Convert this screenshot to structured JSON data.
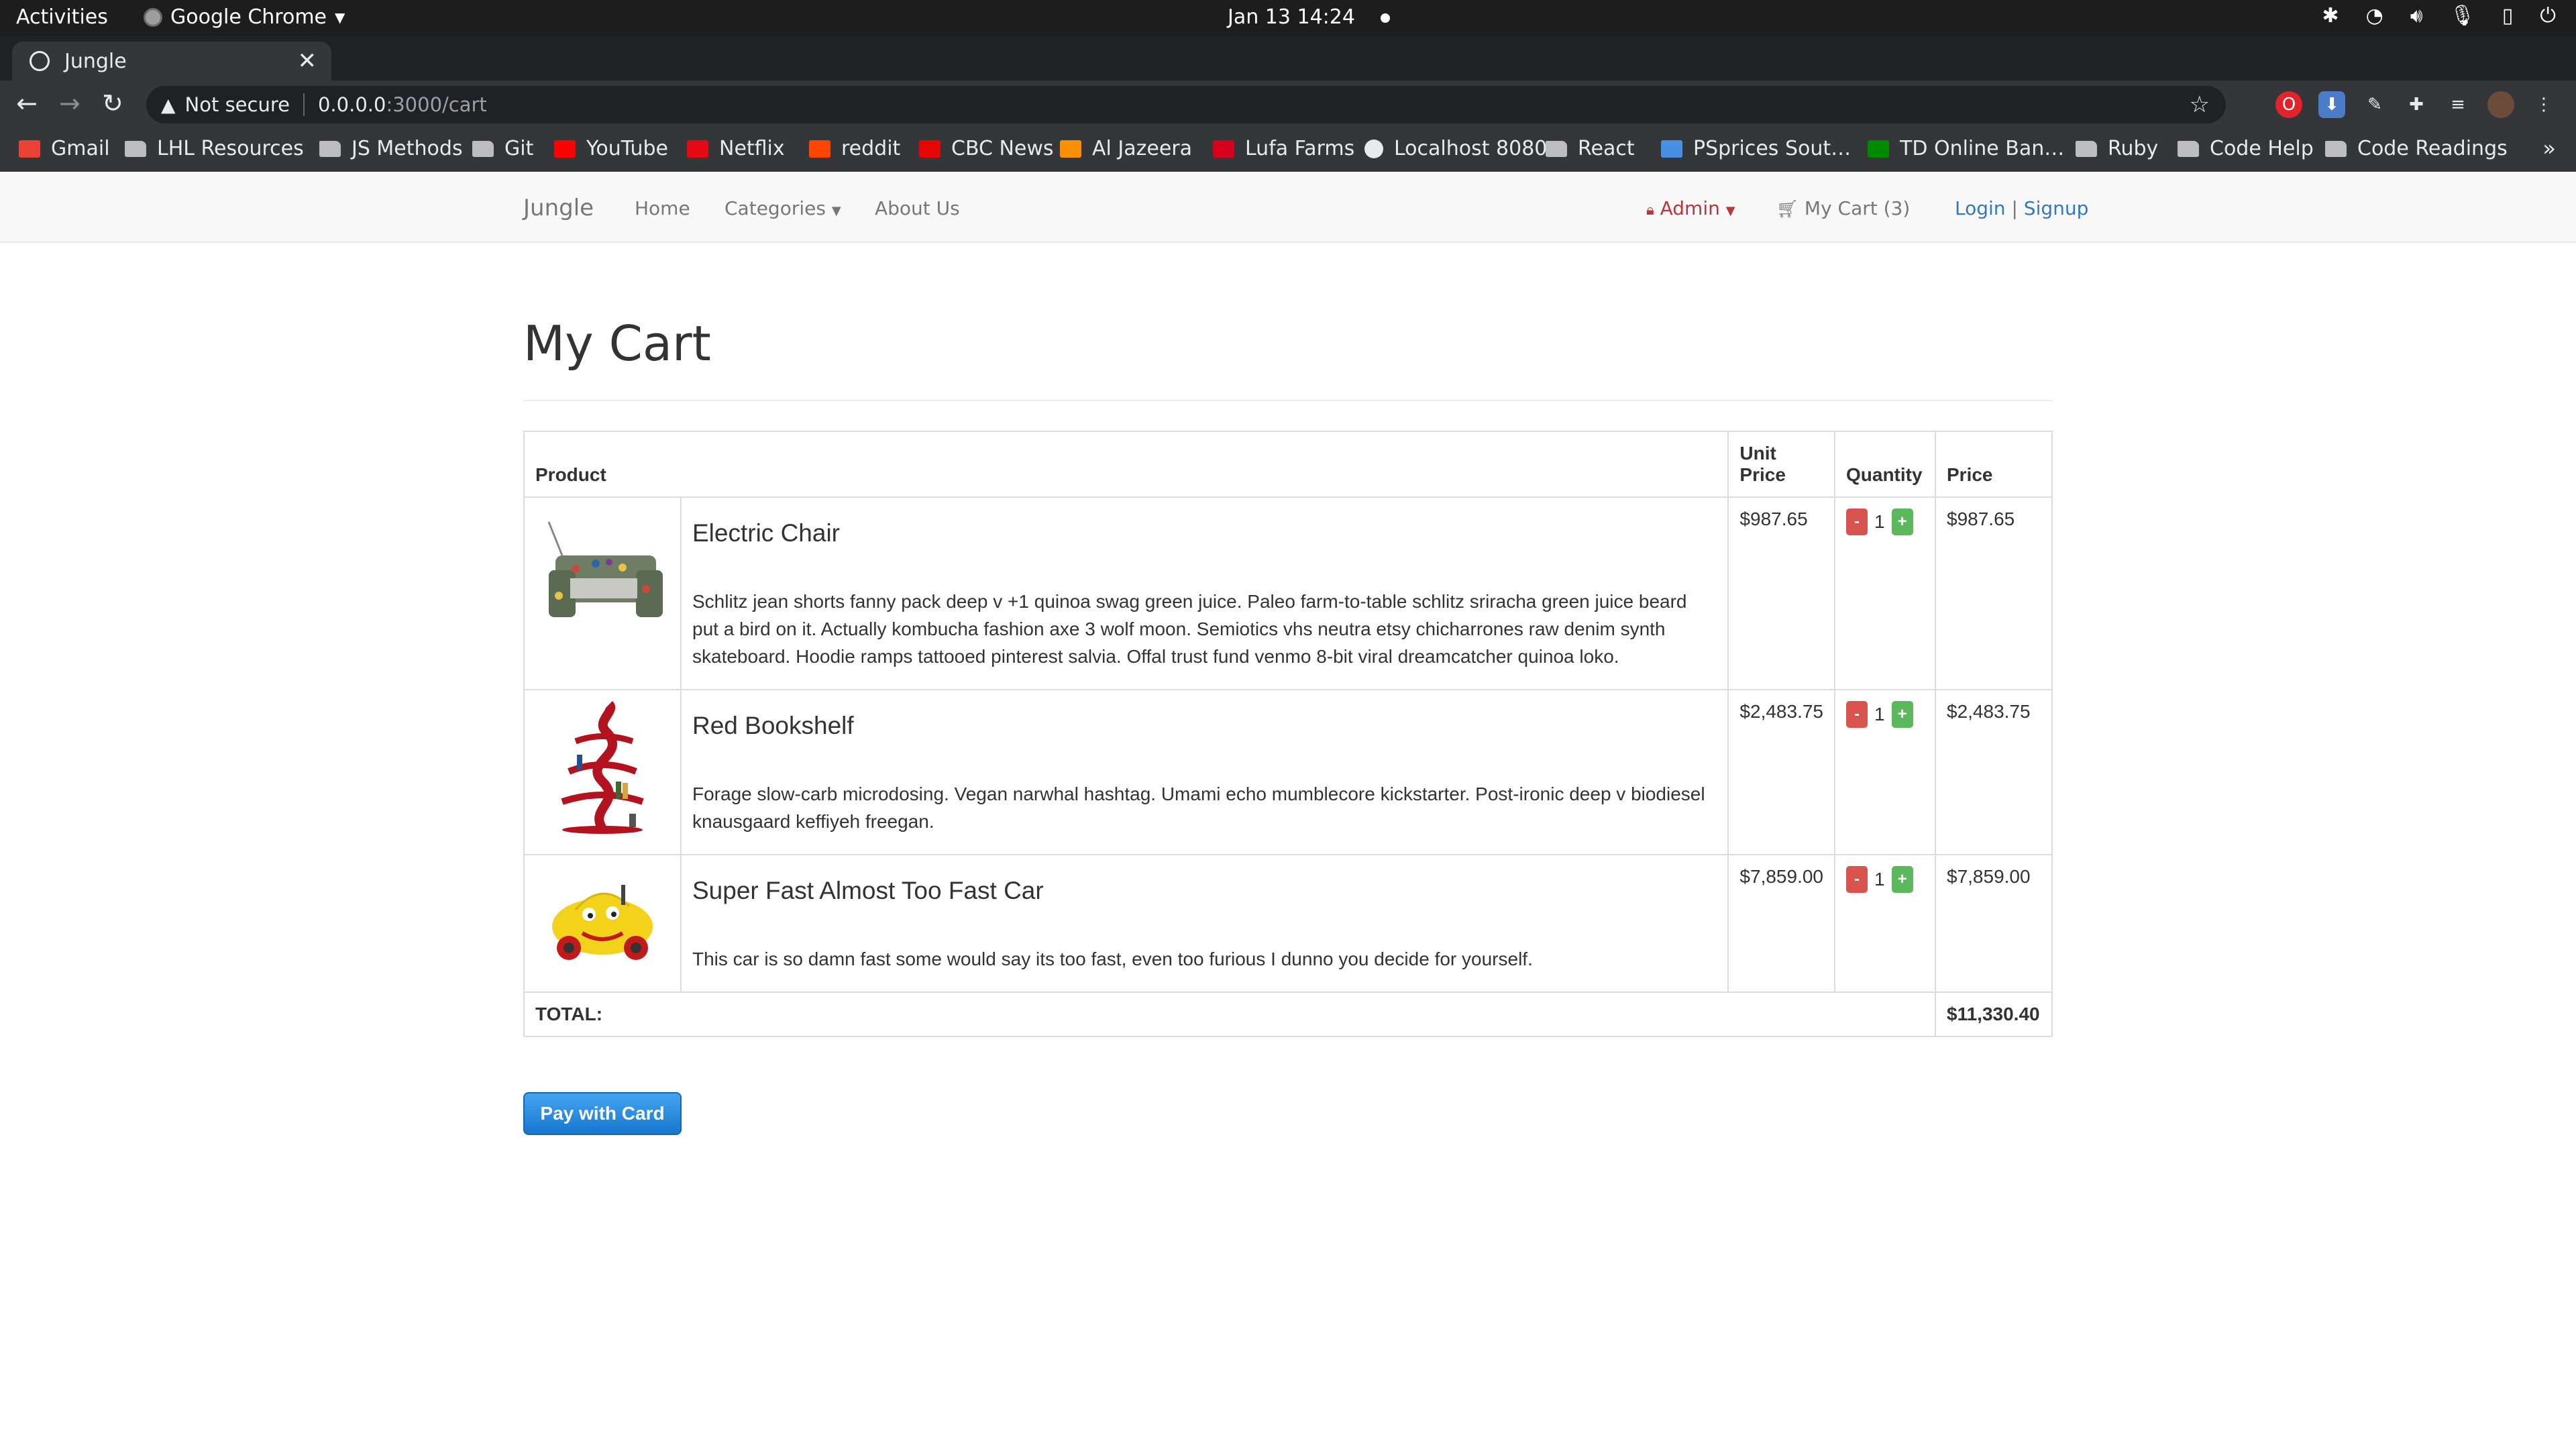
{
  "os": {
    "activities": "Activities",
    "app_name": "Google Chrome",
    "clock": "Jan 13  14:24"
  },
  "browser": {
    "tab_title": "Jungle",
    "omnibox": {
      "security": "Not secure",
      "host": "0.0.0.0",
      "path": ":3000/cart"
    },
    "bookmarks": [
      {
        "label": "Gmail",
        "icon": "gmail-icon",
        "color": "#ea4335"
      },
      {
        "label": "LHL Resources",
        "icon": "folder-icon"
      },
      {
        "label": "JS Methods",
        "icon": "folder-icon"
      },
      {
        "label": "Git",
        "icon": "folder-icon"
      },
      {
        "label": "YouTube",
        "icon": "youtube-icon",
        "color": "#ff0000"
      },
      {
        "label": "Netflix",
        "icon": "netflix-icon",
        "color": "#e50914"
      },
      {
        "label": "reddit",
        "icon": "reddit-icon",
        "color": "#ff4500"
      },
      {
        "label": "CBC News",
        "icon": "cbc-icon",
        "color": "#e60505"
      },
      {
        "label": "Al Jazeera",
        "icon": "aljazeera-icon",
        "color": "#fa9000"
      },
      {
        "label": "Lufa Farms",
        "icon": "lufa-icon",
        "color": "#d6001c"
      },
      {
        "label": "Localhost 8080",
        "icon": "globe-icon"
      },
      {
        "label": "React",
        "icon": "folder-icon"
      },
      {
        "label": "PSprices Sout…",
        "icon": "psprices-icon",
        "color": "#4a90e2"
      },
      {
        "label": "TD Online Ban…",
        "icon": "td-icon",
        "color": "#008a00"
      },
      {
        "label": "Ruby",
        "icon": "folder-icon"
      },
      {
        "label": "Code Help",
        "icon": "folder-icon"
      },
      {
        "label": "Code Readings",
        "icon": "folder-icon"
      }
    ]
  },
  "site_nav": {
    "brand": "Jungle",
    "home": "Home",
    "categories": "Categories",
    "about": "About Us",
    "admin": "Admin",
    "cart": "My Cart (3)",
    "login": "Login",
    "separator": "|",
    "signup": "Signup"
  },
  "page": {
    "title": "My Cart",
    "table": {
      "headers": {
        "product": "Product",
        "unit_price": "Unit Price",
        "quantity": "Quantity",
        "price": "Price"
      },
      "rows": [
        {
          "name": "Electric Chair",
          "description": "Schlitz jean shorts fanny pack deep v +1 quinoa swag green juice. Paleo farm-to-table schlitz sriracha green juice beard put a bird on it. Actually kombucha fashion axe 3 wolf moon. Semiotics vhs neutra etsy chicharrones raw denim synth skateboard. Hoodie ramps tattooed pinterest salvia. Offal trust fund venmo 8-bit viral dreamcatcher quinoa loko.",
          "unit_price": "$987.65",
          "quantity": "1",
          "price": "$987.65"
        },
        {
          "name": "Red Bookshelf",
          "description": "Forage slow-carb microdosing. Vegan narwhal hashtag. Umami echo mumblecore kickstarter. Post-ironic deep v biodiesel knausgaard keffiyeh freegan.",
          "unit_price": "$2,483.75",
          "quantity": "1",
          "price": "$2,483.75"
        },
        {
          "name": "Super Fast Almost Too Fast Car",
          "description": "This car is so damn fast some would say its too fast, even too furious I dunno you decide for yourself.",
          "unit_price": "$7,859.00",
          "quantity": "1",
          "price": "$7,859.00"
        }
      ],
      "total_label": "TOTAL:",
      "total_value": "$11,330.40",
      "minus_label": "-",
      "plus_label": "+"
    },
    "pay_button": "Pay with Card"
  }
}
